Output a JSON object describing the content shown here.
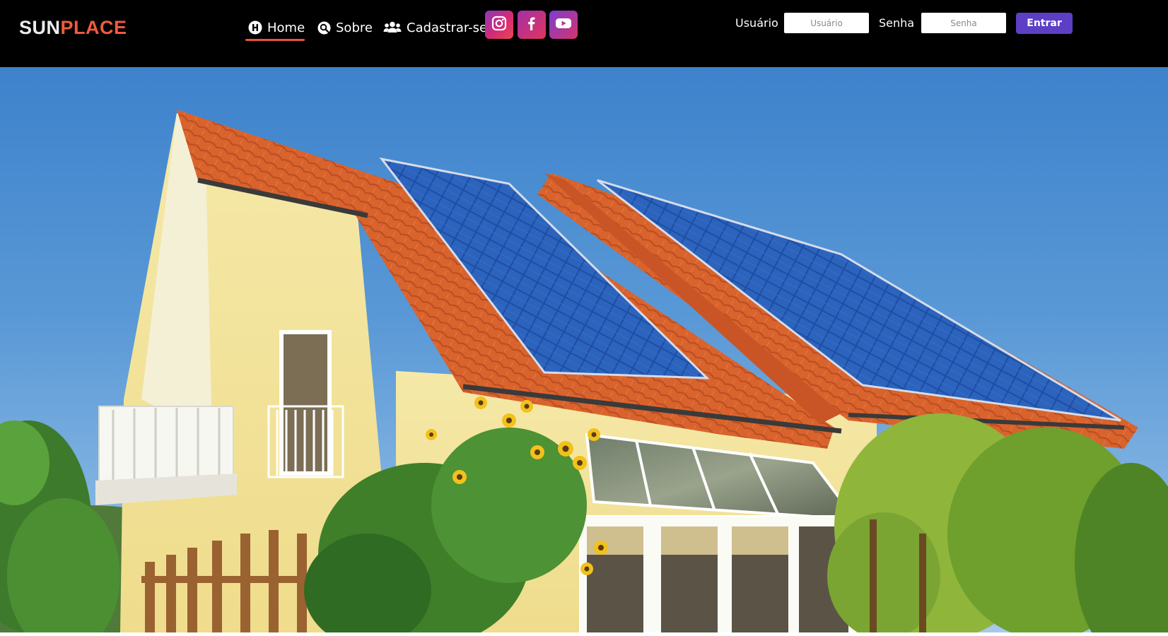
{
  "brand": {
    "part1": "SUN",
    "part2": "PLACE"
  },
  "nav": {
    "items": [
      {
        "label": "Home",
        "icon": "home-circle-icon",
        "active": true
      },
      {
        "label": "Sobre",
        "icon": "search-circle-icon",
        "active": false
      },
      {
        "label": "Cadastrar-se",
        "icon": "users-icon",
        "active": false
      }
    ],
    "active_color": "#e8543b"
  },
  "social": [
    {
      "name": "instagram",
      "icon": "instagram-icon"
    },
    {
      "name": "facebook",
      "icon": "facebook-icon"
    },
    {
      "name": "youtube",
      "icon": "youtube-icon"
    }
  ],
  "login": {
    "user_label": "Usuário",
    "user_placeholder": "Usuário",
    "pass_label": "Senha",
    "pass_placeholder": "Senha",
    "submit_label": "Entrar",
    "submit_color": "#5c3fc4"
  },
  "hero": {
    "image": "house-with-solar-panels-photo"
  },
  "colors": {
    "navbar_bg": "#000000",
    "brand_accent": "#f15a3f"
  }
}
